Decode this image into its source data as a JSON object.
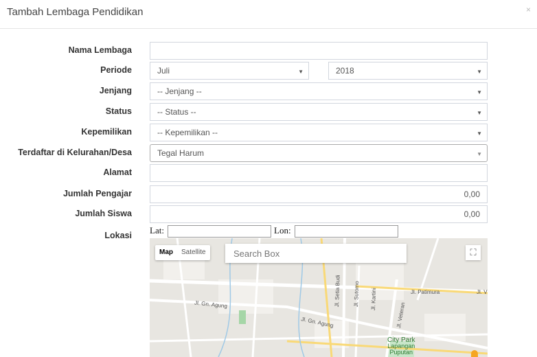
{
  "modal": {
    "title": "Tambah Lembaga Pendidikan",
    "close_glyph": "×"
  },
  "form": {
    "nama_lembaga": {
      "label": "Nama Lembaga",
      "value": ""
    },
    "periode": {
      "label": "Periode",
      "month": "Juli",
      "year": "2018"
    },
    "jenjang": {
      "label": "Jenjang",
      "value": "-- Jenjang --"
    },
    "status": {
      "label": "Status",
      "value": "-- Status --"
    },
    "kepemilikan": {
      "label": "Kepemilikan",
      "value": "-- Kepemilikan --"
    },
    "kelurahan": {
      "label": "Terdaftar di Kelurahan/Desa",
      "value": "Tegal Harum"
    },
    "alamat": {
      "label": "Alamat",
      "value": ""
    },
    "jumlah_pengajar": {
      "label": "Jumlah Pengajar",
      "value": "0,00"
    },
    "jumlah_siswa": {
      "label": "Jumlah Siswa",
      "value": "0,00"
    },
    "lokasi": {
      "label": "Lokasi",
      "lat_label": "Lat:",
      "lon_label": "Lon:"
    }
  },
  "map": {
    "tab_map": "Map",
    "tab_satellite": "Satellite",
    "search_placeholder": "Search Box",
    "fullscreen_icon": "fullscreen-icon",
    "street_labels": [
      "Jl. Gn. Agung",
      "Jl. Gn. Agung",
      "Jl. Setia Budi",
      "Jl. Sutomo",
      "Jl. Kartini",
      "Jl. Veteran",
      "Jl. Patimura",
      "Jl. V"
    ],
    "poi": {
      "line1": "City Park",
      "line2": "Lapangan",
      "line3": "Puputan"
    }
  }
}
